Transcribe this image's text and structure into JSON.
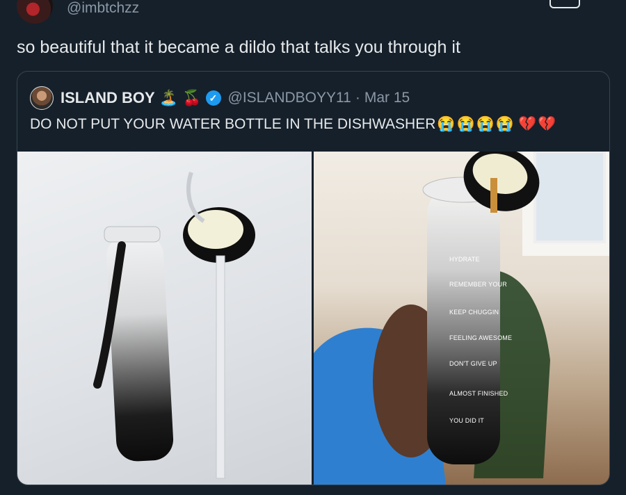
{
  "top": {
    "handle": "@imbtchzz"
  },
  "tweet": {
    "text": "so beautiful that it became a dildo that talks you through it"
  },
  "quote": {
    "name": "ISLAND BOY",
    "name_emojis": [
      "🏝️",
      "🍒"
    ],
    "handle": "@ISLANDBOYY11",
    "separator": "·",
    "date": "Mar 15",
    "text": "DO NOT PUT YOUR WATER BOTTLE IN THE DISHWASHER",
    "text_emojis": [
      "😭",
      "😭",
      "😭",
      "😭",
      "💔",
      "💔"
    ]
  },
  "photos": {
    "right_bottle_labels": [
      "HYDRATE",
      "REMEMBER YOUR",
      "KEEP CHUGGIN",
      "FEELING AWESOME",
      "DON'T GIVE UP",
      "ALMOST FINISHED",
      "YOU DID IT"
    ]
  },
  "colors": {
    "background": "#15202b",
    "text": "#e7e9ea",
    "muted": "#8b98a5",
    "border": "#38444d",
    "verified": "#1d9bf0"
  }
}
